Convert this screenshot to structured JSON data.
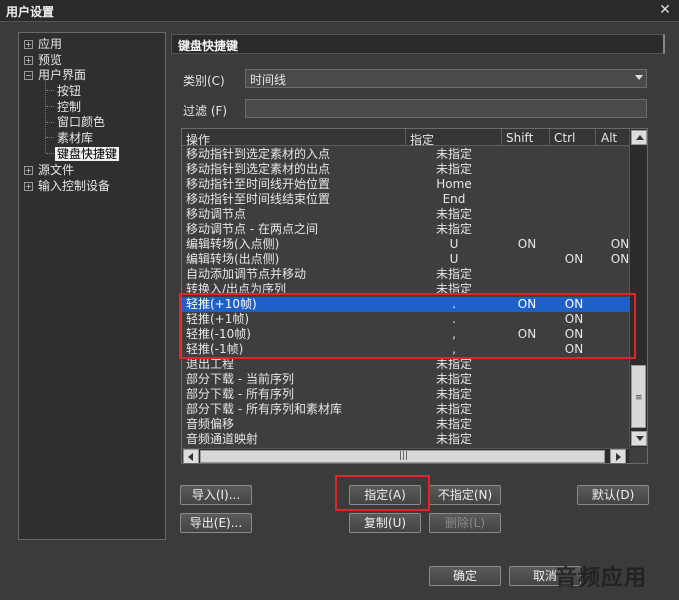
{
  "window": {
    "title": "用户设置",
    "close": "✕"
  },
  "tree": {
    "items": [
      {
        "label": "应用",
        "exp": "+"
      },
      {
        "label": "预览",
        "exp": "+"
      },
      {
        "label": "用户界面",
        "exp": "−"
      },
      {
        "label": "按钮"
      },
      {
        "label": "控制"
      },
      {
        "label": "窗口颜色"
      },
      {
        "label": "素材库"
      },
      {
        "label": "键盘快捷键"
      },
      {
        "label": "源文件",
        "exp": "+"
      },
      {
        "label": "输入控制设备",
        "exp": "+"
      }
    ]
  },
  "section": {
    "title": "键盘快捷键"
  },
  "category": {
    "label": "类别(C)",
    "value": "时间线"
  },
  "filter": {
    "label": "过滤 (F)",
    "value": ""
  },
  "table": {
    "headers": {
      "action": "操作",
      "assign": "指定",
      "shift": "Shift",
      "ctrl": "Ctrl",
      "alt": "Alt"
    },
    "rows": [
      {
        "action": "移动指针到选定素材的入点",
        "key": "未指定",
        "shift": "",
        "ctrl": "",
        "alt": ""
      },
      {
        "action": "移动指针到选定素材的出点",
        "key": "未指定",
        "shift": "",
        "ctrl": "",
        "alt": ""
      },
      {
        "action": "移动指针至时间线开始位置",
        "key": "Home",
        "shift": "",
        "ctrl": "",
        "alt": ""
      },
      {
        "action": "移动指针至时间线结束位置",
        "key": "End",
        "shift": "",
        "ctrl": "",
        "alt": ""
      },
      {
        "action": "移动调节点",
        "key": "未指定",
        "shift": "",
        "ctrl": "",
        "alt": ""
      },
      {
        "action": "移动调节点 - 在两点之间",
        "key": "未指定",
        "shift": "",
        "ctrl": "",
        "alt": ""
      },
      {
        "action": "编辑转场(入点侧)",
        "key": "U",
        "shift": "ON",
        "ctrl": "",
        "alt": "ON"
      },
      {
        "action": "编辑转场(出点侧)",
        "key": "U",
        "shift": "",
        "ctrl": "ON",
        "alt": "ON"
      },
      {
        "action": "自动添加调节点并移动",
        "key": "未指定",
        "shift": "",
        "ctrl": "",
        "alt": ""
      },
      {
        "action": "转换入/出点为序列",
        "key": "未指定",
        "shift": "",
        "ctrl": "",
        "alt": ""
      },
      {
        "action": "轻推(+10帧)",
        "key": ".",
        "shift": "ON",
        "ctrl": "ON",
        "alt": ""
      },
      {
        "action": "轻推(+1帧)",
        "key": ".",
        "shift": "",
        "ctrl": "ON",
        "alt": ""
      },
      {
        "action": "轻推(-10帧)",
        "key": ",",
        "shift": "ON",
        "ctrl": "ON",
        "alt": ""
      },
      {
        "action": "轻推(-1帧)",
        "key": ",",
        "shift": "",
        "ctrl": "ON",
        "alt": ""
      },
      {
        "action": "退出工程",
        "key": "未指定",
        "shift": "",
        "ctrl": "",
        "alt": ""
      },
      {
        "action": "部分下载 - 当前序列",
        "key": "未指定",
        "shift": "",
        "ctrl": "",
        "alt": ""
      },
      {
        "action": "部分下载 - 所有序列",
        "key": "未指定",
        "shift": "",
        "ctrl": "",
        "alt": ""
      },
      {
        "action": "部分下载 - 所有序列和素材库",
        "key": "未指定",
        "shift": "",
        "ctrl": "",
        "alt": ""
      },
      {
        "action": "音频偏移",
        "key": "未指定",
        "shift": "",
        "ctrl": "",
        "alt": ""
      },
      {
        "action": "音频通道映射",
        "key": "未指定",
        "shift": "",
        "ctrl": "",
        "alt": ""
      }
    ]
  },
  "buttons": {
    "import": "导入(I)...",
    "export": "导出(E)...",
    "assign": "指定(A)",
    "unassign": "不指定(N)",
    "duplicate": "复制(U)",
    "delete": "删除(L)",
    "default": "默认(D)",
    "ok": "确定",
    "cancel": "取消"
  },
  "watermark": "音频应用",
  "colors": {
    "highlight_red": "#e0242a",
    "selection_blue": "#1f5fc8"
  }
}
